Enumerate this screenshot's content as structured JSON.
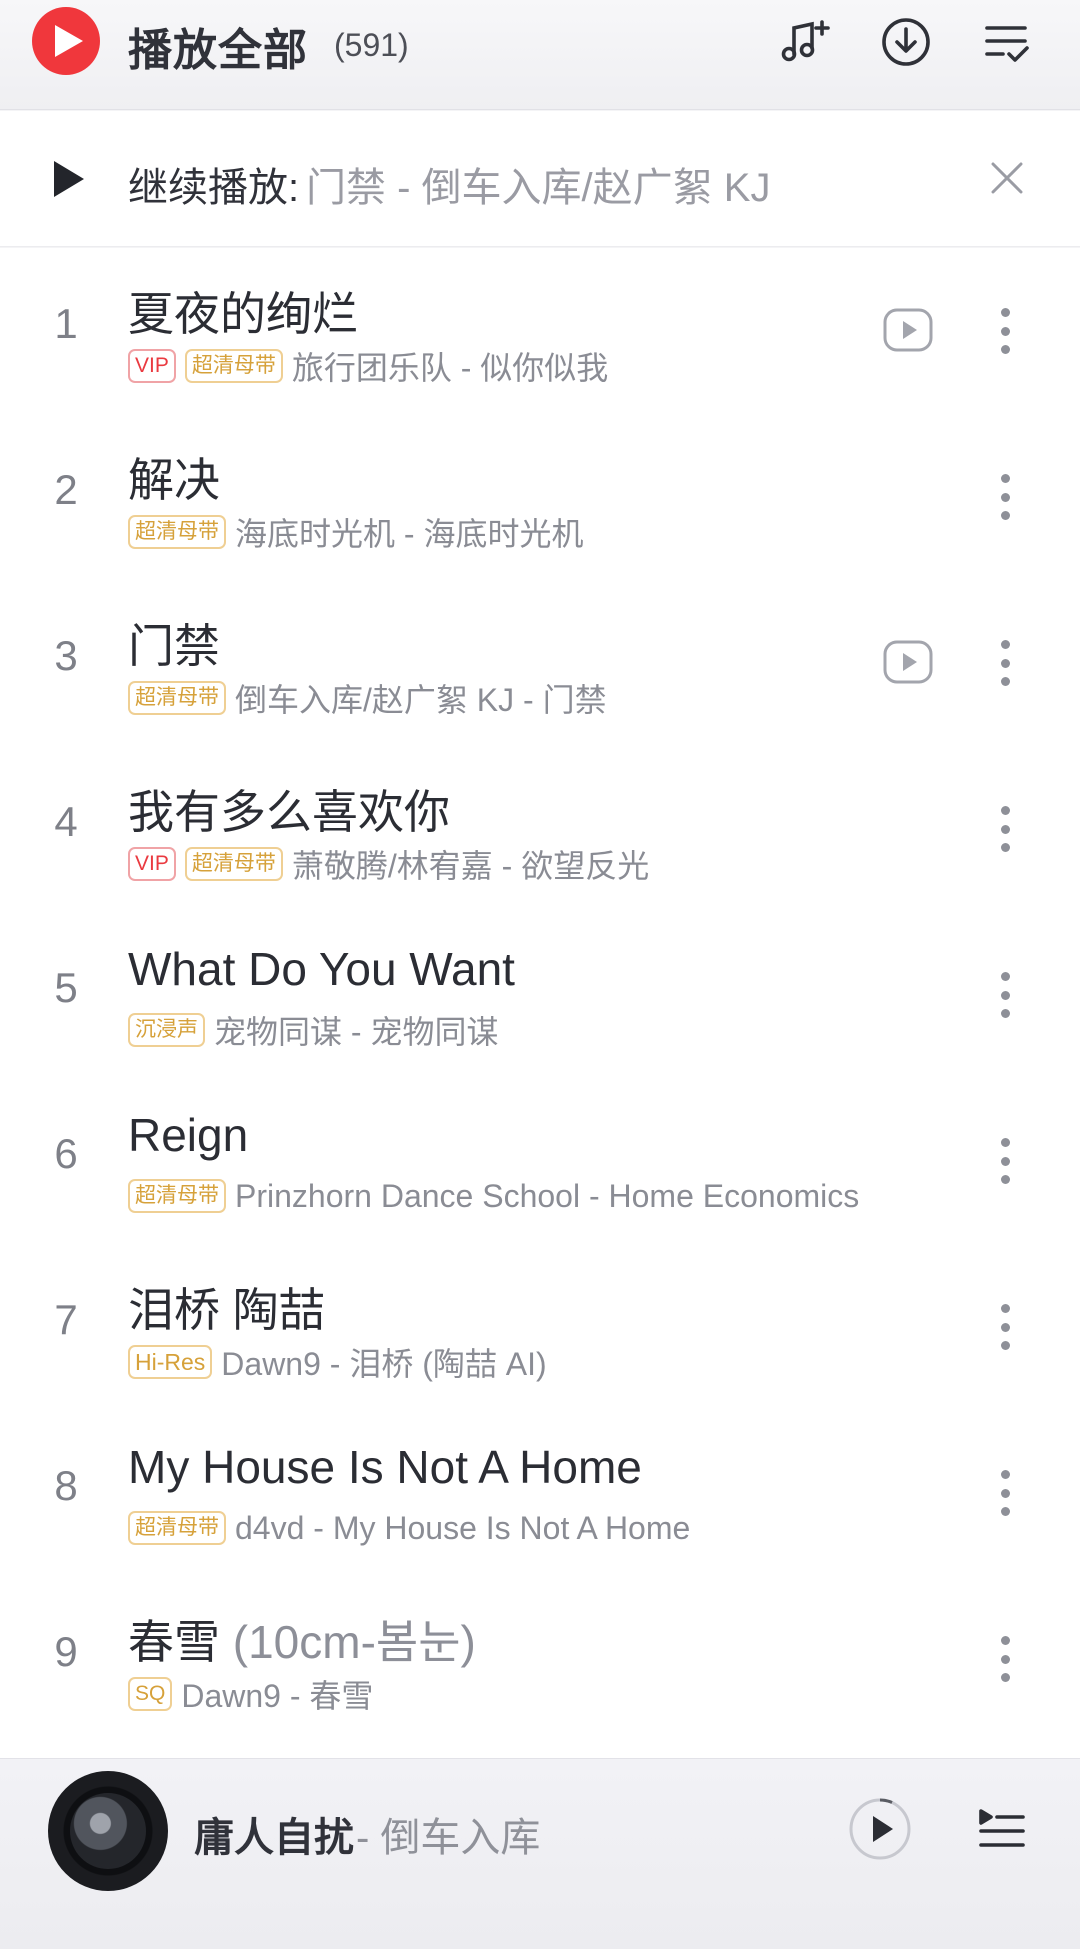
{
  "header": {
    "play_all_label": "播放全部",
    "count": "(591)",
    "icons": [
      "add-music-icon",
      "download-icon",
      "multi-select-icon"
    ]
  },
  "resume": {
    "label": "继续播放:",
    "track": "门禁 - 倒车入库/赵广絮 KJ",
    "icons": [
      "play-icon",
      "close-icon"
    ]
  },
  "songs": [
    {
      "num": "1",
      "title": "夏夜的绚烂",
      "title_extra": "",
      "badges": [
        {
          "text": "VIP",
          "kind": "vip"
        },
        {
          "text": "超清母带",
          "kind": "gold"
        }
      ],
      "sub": "旅行团乐队 - 似你似我",
      "mv": true
    },
    {
      "num": "2",
      "title": "解决",
      "title_extra": "",
      "badges": [
        {
          "text": "超清母带",
          "kind": "gold"
        }
      ],
      "sub": "海底时光机 - 海底时光机",
      "mv": false
    },
    {
      "num": "3",
      "title": "门禁",
      "title_extra": "",
      "badges": [
        {
          "text": "超清母带",
          "kind": "gold"
        }
      ],
      "sub": "倒车入库/赵广絮 KJ - 门禁",
      "mv": true
    },
    {
      "num": "4",
      "title": "我有多么喜欢你",
      "title_extra": "",
      "badges": [
        {
          "text": "VIP",
          "kind": "vip"
        },
        {
          "text": "超清母带",
          "kind": "gold"
        }
      ],
      "sub": "萧敬腾/林宥嘉 - 欲望反光",
      "mv": false
    },
    {
      "num": "5",
      "title": "What Do You Want",
      "title_extra": "",
      "badges": [
        {
          "text": "沉浸声",
          "kind": "gold"
        }
      ],
      "sub": "宠物同谋 - 宠物同谋",
      "mv": false
    },
    {
      "num": "6",
      "title": "Reign",
      "title_extra": "",
      "badges": [
        {
          "text": "超清母带",
          "kind": "gold"
        }
      ],
      "sub": "Prinzhorn Dance School - Home Economics",
      "mv": false
    },
    {
      "num": "7",
      "title": "泪桥 陶喆",
      "title_extra": "",
      "badges": [
        {
          "text": "Hi-Res",
          "kind": "hires"
        }
      ],
      "sub": "Dawn9 - 泪桥 (陶喆 AI)",
      "mv": false
    },
    {
      "num": "8",
      "title": "My House Is Not A Home",
      "title_extra": "",
      "badges": [
        {
          "text": "超清母带",
          "kind": "gold"
        }
      ],
      "sub": "d4vd - My House Is Not A Home",
      "mv": false
    },
    {
      "num": "9",
      "title": "春雪",
      "title_extra": " (10cm-봄눈)",
      "badges": [
        {
          "text": "SQ",
          "kind": "gold"
        }
      ],
      "sub": "Dawn9 - 春雪",
      "mv": false
    }
  ],
  "player": {
    "title": "庸人自扰",
    "artist": " - 倒车入库",
    "icons": [
      "album-art",
      "play-icon",
      "playlist-queue-icon"
    ]
  },
  "colors": {
    "accent_red": "#f0373c",
    "badge_gold": "#d6a13a",
    "badge_vip": "#ea3a40"
  }
}
